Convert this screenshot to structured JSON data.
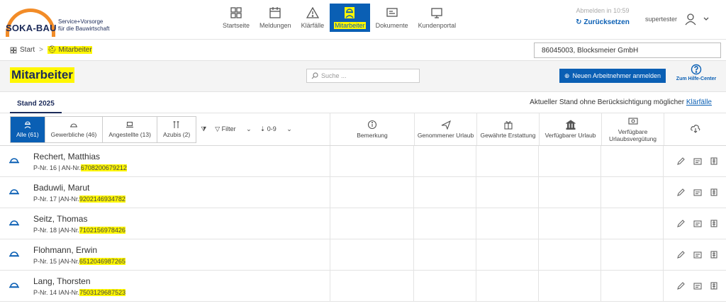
{
  "brand": {
    "name": "SOKA-BAU",
    "tagline_line1": "Service+Vorsorge",
    "tagline_line2": "für die Bauwirtschaft",
    "accent": "#f28c28",
    "primary": "#0a5fb4"
  },
  "nav": [
    {
      "label": "Startseite",
      "icon": "dashboard-icon"
    },
    {
      "label": "Meldungen",
      "icon": "calendar-icon"
    },
    {
      "label": "Klärfälle",
      "icon": "warning-icon"
    },
    {
      "label": "Mitarbeiter",
      "icon": "worker-icon",
      "active": true
    },
    {
      "label": "Dokumente",
      "icon": "document-icon"
    },
    {
      "label": "Kundenportal",
      "icon": "monitor-icon"
    }
  ],
  "session": {
    "logout_text": "Abmelden in 10:59",
    "back_label": "Zurücksetzen",
    "username": "supertester"
  },
  "breadcrumb": {
    "start": "Start",
    "current": "Mitarbeiter"
  },
  "company_select": "86045003, Blocksmeier GmbH",
  "page": {
    "title": "Mitarbeiter",
    "search_placeholder": "Suche ...",
    "new_button": "Neuen Arbeitnehmer anmelden",
    "help_label": "Zum Hilfe-Center"
  },
  "stand": {
    "tab": "Stand 2025",
    "note": "Aktueller Stand ohne Berücksichtigung möglicher",
    "note_link": "Klärfälle"
  },
  "filters": {
    "segments": [
      {
        "label": "Alle (61)",
        "active": true
      },
      {
        "label": "Gewerbliche (46)"
      },
      {
        "label": "Angestellte (13)"
      },
      {
        "label": "Azubis (2)"
      }
    ],
    "filter_label": "Filter",
    "sort_label": "0-9"
  },
  "columns": [
    {
      "label": "Bemerkung",
      "icon": "info-icon"
    },
    {
      "label": "Genommener Urlaub",
      "icon": "plane-icon"
    },
    {
      "label": "Gewährte Erstattung",
      "icon": "gift-icon"
    },
    {
      "label": "Verfügbarer Urlaub",
      "icon": "bank-icon"
    },
    {
      "label": "Verfügbare Urlaubsvergütung",
      "icon": "money-icon"
    }
  ],
  "employees": [
    {
      "name": "Rechert, Matthias",
      "pnr": "P-Nr. 16 | AN-Nr.",
      "an": "6708200679212"
    },
    {
      "name": "Baduwli, Marut",
      "pnr": "P-Nr. 17 |AN-Nr.",
      "an": "9202146934782"
    },
    {
      "name": "Seitz, Thomas",
      "pnr": "P-Nr. 18 |AN-Nr.",
      "an": "7102156978426"
    },
    {
      "name": "Flohmann, Erwin",
      "pnr": "P-Nr. 15 |AN-Nr.",
      "an": "6512046987265"
    },
    {
      "name": "Lang, Thorsten",
      "pnr": "P-Nr. 14 IAN-Nr.",
      "an": "7503129687523"
    }
  ]
}
